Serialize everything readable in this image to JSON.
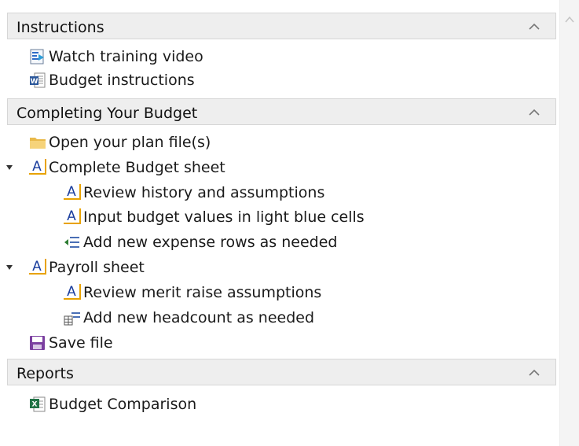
{
  "sections": [
    {
      "title": "Instructions",
      "items": [
        {
          "label": "Watch training video",
          "icon": "video-icon"
        },
        {
          "label": "Budget instructions",
          "icon": "word-document-icon"
        }
      ]
    },
    {
      "title": "Completing Your Budget",
      "items": [
        {
          "label": "Open your plan file(s)",
          "icon": "folder-icon"
        },
        {
          "label": "Complete Budget sheet",
          "icon": "sheet-a-icon",
          "expanded": true
        },
        {
          "label": "Review history and assumptions",
          "icon": "sheet-a-icon"
        },
        {
          "label": "Input budget values in light blue cells",
          "icon": "sheet-a-icon"
        },
        {
          "label": "Add new expense rows as needed",
          "icon": "insert-rows-icon"
        },
        {
          "label": "Payroll sheet",
          "icon": "sheet-a-icon",
          "expanded": true
        },
        {
          "label": "Review merit raise assumptions",
          "icon": "sheet-a-icon"
        },
        {
          "label": "Add new headcount as needed",
          "icon": "insert-table-icon"
        },
        {
          "label": "Save file",
          "icon": "save-icon"
        }
      ]
    },
    {
      "title": "Reports",
      "items": [
        {
          "label": "Budget Comparison",
          "icon": "excel-icon"
        }
      ]
    }
  ],
  "colors": {
    "header_bg": "#eeeeee",
    "accent_orange": "#e8a200",
    "icon_blue": "#1c3f9e",
    "save_purple": "#7b3fa0"
  }
}
